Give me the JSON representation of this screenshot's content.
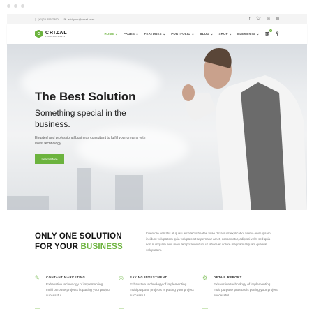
{
  "topbar": {
    "phone": "(+1)23.456.7890",
    "email": "add.your@email.here",
    "social": [
      "f",
      "t",
      "ig",
      "in"
    ]
  },
  "brand": {
    "name": "CRIZAL",
    "tagline": "FOR ALL BUSINESS",
    "color": "#6cb33e"
  },
  "nav": {
    "items": [
      "HOME",
      "PAGES",
      "FEATURES",
      "PORTFOLIO",
      "BLOG",
      "SHOP",
      "ELEMENTS"
    ],
    "active": "HOME",
    "cart_count": "0"
  },
  "hero": {
    "title": "The Best Solution",
    "subtitle": "Something special in the business.",
    "text": "Etrusted and professional business consultant to fulfill your dreams with latest technology.",
    "button": "Learn More"
  },
  "intro": {
    "heading_line1": "ONLY ONE SOLUTION",
    "heading_line2_prefix": "FOR YOUR ",
    "heading_highlight": "BUSINESS",
    "text": "Inventore veritatis et quasi architecto beatae vitae dicta sunt explicabo. Nemo enim ipsam incidunt voluptatem quia voluptas sit aspernatur amet, consectetur, adipisci velit, sed quia non numquam eius modi tempora incidunt ut labore et dolore magnam aliquam quaerat voluptatem."
  },
  "features": [
    {
      "icon": "marketing-icon",
      "title": "CONTANT MARKETING",
      "text": "Exhaustive technology of implementing multi purpose projects is putting your project successful."
    },
    {
      "icon": "coins-icon",
      "title": "SAVING INVESTMENT",
      "text": "Exhaustive technology of implementing multi purpose projects is putting your project successful."
    },
    {
      "icon": "gears-icon",
      "title": "DETAIL REPORT",
      "text": "Exhaustive technology of implementing multi purpose projects is putting your project successful."
    }
  ]
}
